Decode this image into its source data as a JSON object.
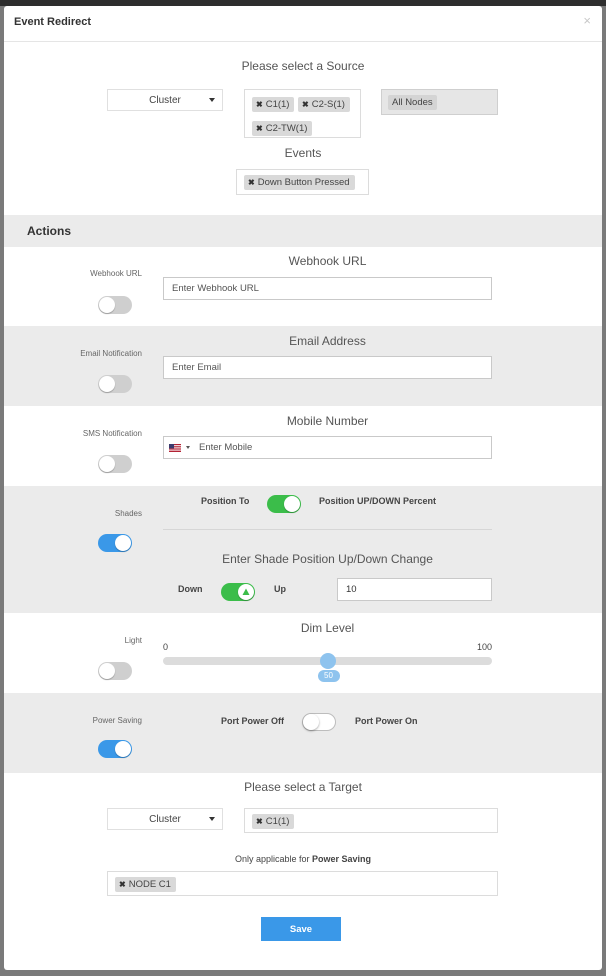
{
  "modal": {
    "title": "Event Redirect",
    "close_glyph": "×"
  },
  "source": {
    "heading": "Please select a Source",
    "type_select": "Cluster",
    "clusters": [
      "C1(1)",
      "C2-S(1)",
      "C2-TW(1)"
    ],
    "nodes": "All Nodes",
    "events_heading": "Events",
    "events": [
      "Down Button Pressed"
    ]
  },
  "actions": {
    "heading": "Actions",
    "webhook": {
      "side_label": "Webhook URL",
      "title": "Webhook URL",
      "placeholder": "Enter Webhook URL",
      "enabled": false
    },
    "email": {
      "side_label": "Email Notification",
      "title": "Email Address",
      "placeholder": "Enter Email",
      "enabled": false
    },
    "sms": {
      "side_label": "SMS Notification",
      "title": "Mobile Number",
      "placeholder": "Enter Mobile",
      "enabled": false
    },
    "shades": {
      "side_label": "Shades",
      "enabled": true,
      "position_to_label": "Position To",
      "position_to_on": true,
      "percent_label": "Position UP/DOWN Percent",
      "change_title": "Enter Shade Position Up/Down Change",
      "down_label": "Down",
      "up_label": "Up",
      "direction_up": true,
      "change_value": "10"
    },
    "light": {
      "side_label": "Light",
      "enabled": false,
      "title": "Dim Level",
      "min": "0",
      "max": "100",
      "value": "50",
      "fraction": 0.5
    },
    "power": {
      "side_label": "Power Saving",
      "enabled": true,
      "off_label": "Port Power Off",
      "on_label": "Port Power On",
      "port_on": false
    }
  },
  "target": {
    "heading": "Please select a Target",
    "type_select": "Cluster",
    "clusters": [
      "C1(1)"
    ],
    "note_prefix": "Only applicable for ",
    "note_bold": "Power Saving",
    "nodes": [
      "NODE C1"
    ]
  },
  "footer": {
    "save_label": "Save"
  },
  "colors": {
    "accent": "#3a98e8",
    "toggle_green": "#3bbd4a",
    "band_gray": "#ebebeb"
  }
}
